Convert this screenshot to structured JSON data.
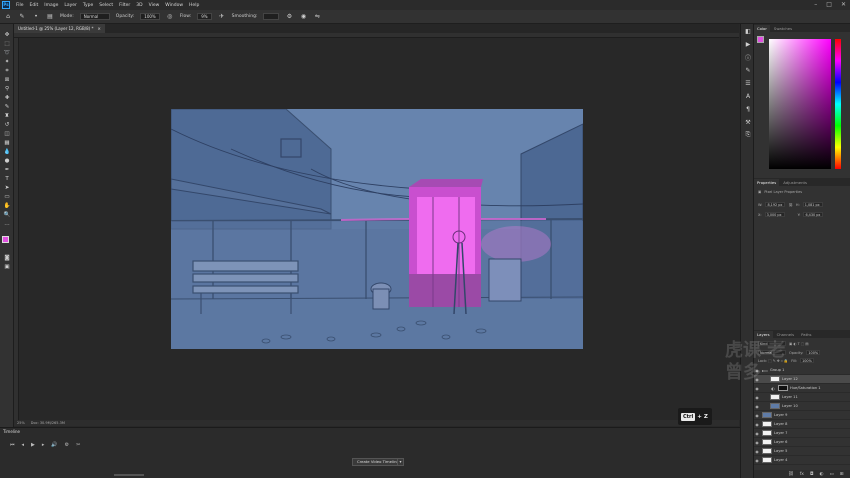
{
  "menu": [
    "File",
    "Edit",
    "Image",
    "Layer",
    "Type",
    "Select",
    "Filter",
    "3D",
    "View",
    "Window",
    "Help"
  ],
  "options": {
    "mode_label": "Mode:",
    "mode_value": "Normal",
    "opacity_label": "Opacity:",
    "opacity_value": "100%",
    "flow_label": "Flow:",
    "flow_value": "9%",
    "smoothing_label": "Smoothing:"
  },
  "document": {
    "tab_title": "Untitled-1 @ 25% (Layer 12, RGB/8) *",
    "tab_close": "×"
  },
  "status": {
    "zoom": "25%",
    "doc_info": "Doc: 30.9M/265.3M"
  },
  "timeline": {
    "title": "Timeline",
    "create_button": "Create Video Timeline"
  },
  "shortcut_overlay": {
    "key": "Ctrl",
    "plus": "+",
    "letter": "Z"
  },
  "panels": {
    "color_tabs": [
      "Color",
      "Swatches"
    ],
    "properties_tabs": [
      "Properties",
      "Adjustments"
    ],
    "properties_title": "Pixel Layer Properties",
    "prop_w": "8,192 px",
    "prop_h": "1,081 px",
    "prop_x": "3,000 px",
    "prop_y": "6,430 px",
    "layers_tabs": [
      "Layers",
      "Channels",
      "Paths"
    ],
    "layers_kind": "Kind",
    "layers_mode": "Normal",
    "layers_opacity_label": "Opacity:",
    "layers_opacity": "100%",
    "layers_fill_label": "Fill:",
    "layers_fill": "100%"
  },
  "layers": [
    {
      "name": "Group 1",
      "selected": false,
      "thumb": "folder"
    },
    {
      "name": "Layer 12",
      "selected": true,
      "thumb": "white"
    },
    {
      "name": "Hue/Saturation 1",
      "selected": false,
      "thumb": "mask"
    },
    {
      "name": "Layer 11",
      "selected": false,
      "thumb": "white"
    },
    {
      "name": "Layer 10",
      "selected": false,
      "thumb": "blue"
    },
    {
      "name": "Layer 9",
      "selected": false,
      "thumb": "blue"
    },
    {
      "name": "Layer 8",
      "selected": false,
      "thumb": "white"
    },
    {
      "name": "Layer 7",
      "selected": false,
      "thumb": "white"
    },
    {
      "name": "Layer 6",
      "selected": false,
      "thumb": "white"
    },
    {
      "name": "Layer 5",
      "selected": false,
      "thumb": "white"
    },
    {
      "name": "Layer 4",
      "selected": false,
      "thumb": "white"
    }
  ],
  "colors": {
    "foreground": "#e050e0",
    "artwork_bg": "#5f7ba6"
  },
  "watermark": "虎课 老曾多"
}
